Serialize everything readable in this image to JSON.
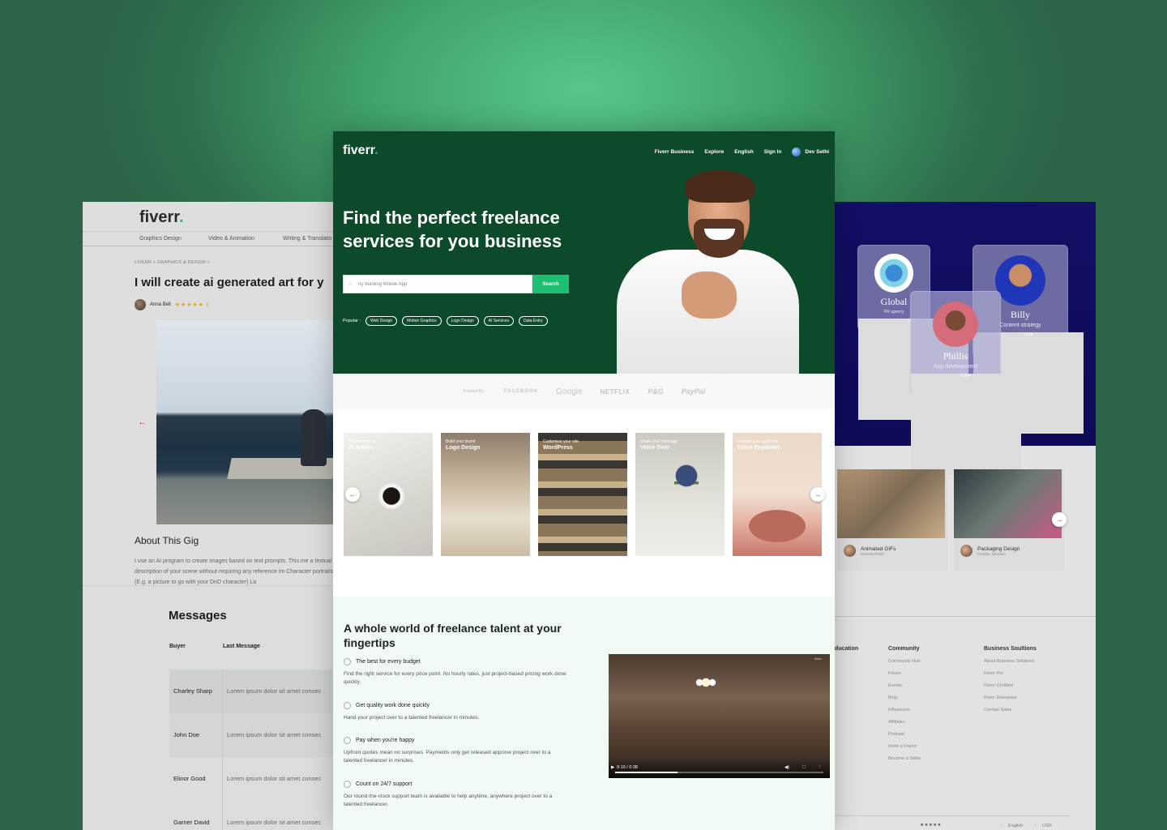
{
  "left": {
    "logo": "fiverr",
    "logo_dot": ".",
    "categories": [
      "Graphics Design",
      "Video & Animation",
      "Writing & Translatio"
    ],
    "breadcrumb": "LIVERR > GRAPHICS & DESIGN >",
    "gig_title": "I will create ai generated art for y",
    "seller_name": "Anna Bell",
    "stars": "★★★★★",
    "rating": "5",
    "prev_arrow": "←",
    "about_heading": "About This Gig",
    "about_text": "I use an AI program to create images based on text prompts. This me a textual description of your scene without requiring any reference im Character portraits (E.g. a picture to go with your DnD character) La",
    "messages_title": "Messages",
    "col_buyer": "Buyer",
    "col_last": "Last Message",
    "rows": [
      {
        "buyer": "Charley Sharp",
        "message": "Lorem ipsum dolor sit amet consec"
      },
      {
        "buyer": "John Doe",
        "message": "Lorem ipsum dolor sit amet consec"
      },
      {
        "buyer": "Elinor Good",
        "message": "Lorem ipsum dolor sit amet consec"
      },
      {
        "buyer": "Garner David",
        "message": "Lorem ipsum dolor sit amet consec"
      }
    ]
  },
  "center": {
    "logo": "fiverr",
    "logo_dot": ".",
    "nav": [
      "Fiverr Business",
      "Explore",
      "English",
      "Sign In",
      "Dev Sethi"
    ],
    "headline": "Find the perfect freelance services for you business",
    "search_placeholder": "Try building Mobile App",
    "search_button": "Search",
    "popular_label": "Popular :",
    "popular_tags": [
      "Web Design",
      "Motion Graphics",
      "Logo Design",
      "AI Services",
      "Data Entry"
    ],
    "trusted_label": "Trusted By :",
    "trusted_brands": [
      "FACEBOOK",
      "Google",
      "NETFLIX",
      "P&G",
      "PayPal"
    ],
    "cards": [
      {
        "sub": "Add talent to AI",
        "title": "AI Artists"
      },
      {
        "sub": "Build your brand",
        "title": "Logo Design"
      },
      {
        "sub": "Customize your site",
        "title": "WordPress"
      },
      {
        "sub": "Share your message",
        "title": "Voice Over"
      },
      {
        "sub": "Engage your audience",
        "title": "Video Explainer"
      }
    ],
    "carousel_prev": "←",
    "carousel_next": "→",
    "talent_heading": "A whole world of freelance talent at your fingertips",
    "features": [
      {
        "title": "The best for every budget",
        "desc": "Find the right service for every price point. No hourly rates, just project-based pricing work done quickly."
      },
      {
        "title": "Get quality work done quickly",
        "desc": "Hand your project over to a talented freelancer in minutes."
      },
      {
        "title": "Pay when you're happy",
        "desc": "Upfront quotes mean no surprises. Payments only get released approve project over to a talented freelancer in minutes."
      },
      {
        "title": "Count on 24/7 support",
        "desc": "Our round-the-clock support team is available to help anytime, anywhere project over to a talented freelancer."
      }
    ],
    "video_time": "0:10 / 0:38",
    "video_watermark": "fiverr"
  },
  "right": {
    "profiles": [
      {
        "name": "Global",
        "role": "PR agency",
        "rating": "5.0★"
      },
      {
        "name": "Billy",
        "role": "Content strategy",
        "rating": "5.0★"
      },
      {
        "name": "Phillis",
        "role": "App development",
        "rating": "5.0★"
      }
    ],
    "tiles": [
      {
        "title": "Animated GIFs",
        "author": "Emmett Potter"
      },
      {
        "title": "Packaging Design",
        "author": "Freddie Johnston"
      }
    ],
    "tile_next": "→",
    "footer_cols": [
      {
        "heading": "ducation",
        "links": []
      },
      {
        "heading": "Community",
        "links": [
          "Community Hub",
          "Forum",
          "Events",
          "Blog",
          "Influencers",
          "Affiliates",
          "Podcast",
          "Invite a Friend",
          "Become a Seller"
        ]
      },
      {
        "heading": "Business Soultions",
        "links": [
          "About Business Solutions",
          "Fiverr Pro",
          "Fiverr Certified",
          "Fiverr Enterprise",
          "Contact Sales"
        ]
      }
    ],
    "language": "English",
    "currency": "USD"
  },
  "colors": {
    "brand_green": "#1dbf73",
    "hero_green": "#0d4a2a",
    "navy": "#120f66",
    "talent_bg": "#f0fbf4"
  }
}
